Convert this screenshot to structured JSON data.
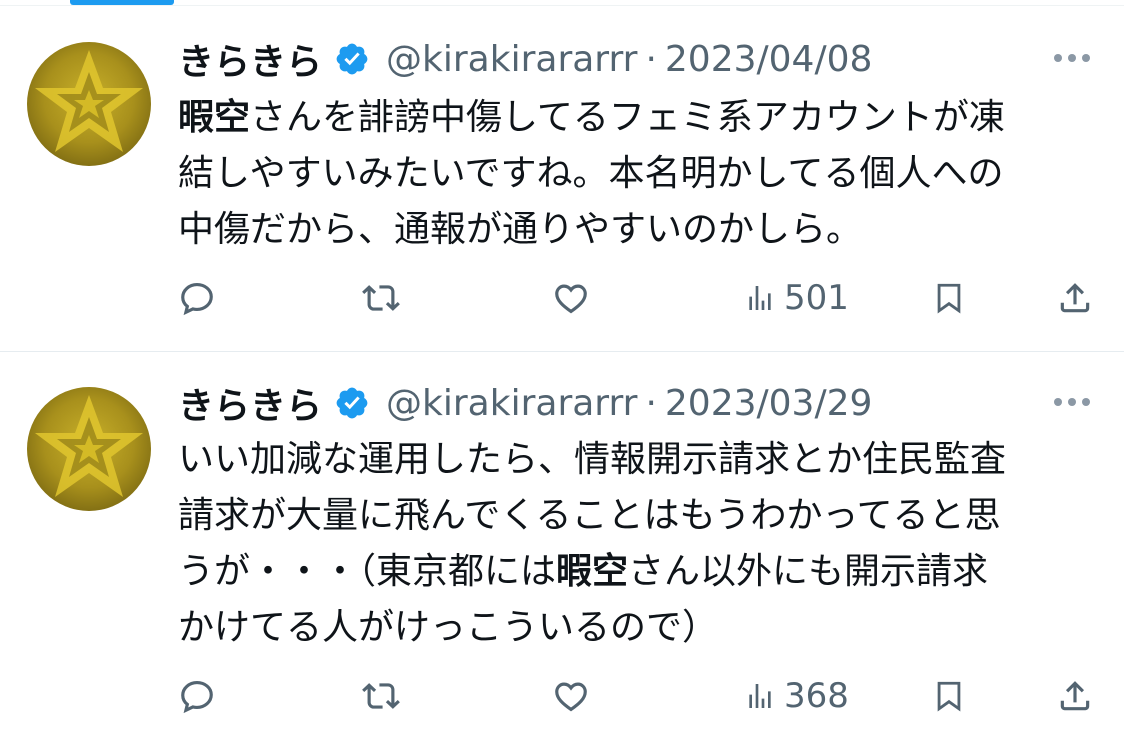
{
  "colors": {
    "accent": "#1d9bf0",
    "text": "#0f1419",
    "secondary": "#536471"
  },
  "tweets": [
    {
      "name": "きらきら",
      "handle": "@kirakirararrr",
      "separator": "·",
      "date": "2023/04/08",
      "lines": [
        [
          {
            "t": "暇空",
            "bold": true
          },
          {
            "t": "さんを誹謗中傷してるフェミ系アカウントが凍",
            "bold": false
          }
        ],
        [
          {
            "t": "結しやすいみたいですね。本名明かしてる個人への",
            "bold": false
          }
        ],
        [
          {
            "t": "中傷だから、通報が通りやすいのかしら。",
            "bold": false
          }
        ]
      ],
      "views": "501"
    },
    {
      "name": "きらきら",
      "handle": "@kirakirararrr",
      "separator": "·",
      "date": "2023/03/29",
      "lines": [
        [
          {
            "t": "いい加減な運用したら、情報開示請求とか住民監査",
            "bold": false
          }
        ],
        [
          {
            "t": "請求が大量に飛んでくることはもうわかってると思",
            "bold": false
          }
        ],
        [
          {
            "t": "うが・・・（東京都には",
            "bold": false
          },
          {
            "t": "暇空",
            "bold": true
          },
          {
            "t": "さん以外にも開示請求",
            "bold": false
          }
        ],
        [
          {
            "t": "かけてる人がけっこういるので）",
            "bold": false
          }
        ]
      ],
      "views": "368"
    }
  ],
  "icons": {
    "verified": "verified-badge-icon",
    "more": "more-options-icon",
    "reply": "reply-icon",
    "retweet": "retweet-icon",
    "like": "like-icon",
    "views": "views-icon",
    "bookmark": "bookmark-icon",
    "share": "share-icon"
  }
}
